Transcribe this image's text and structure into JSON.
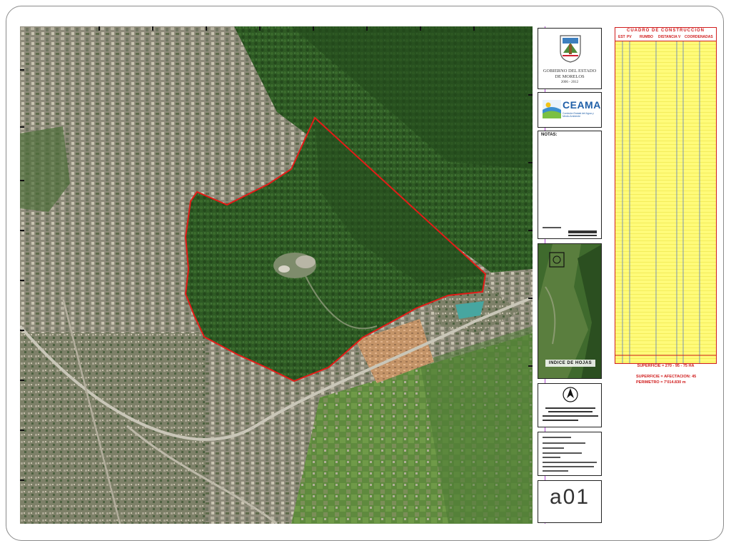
{
  "map": {
    "description_label": "aerial-orthophoto",
    "boundary_color": "#e41b17",
    "forest_color": "#2c5a22",
    "urban_color": "#8c8a78"
  },
  "title_block": {
    "government": {
      "line1": "GOBIERNO DEL ESTADO",
      "line2": "DE MORELOS",
      "period": "2006 - 2012"
    },
    "agency": {
      "logo_text": "CEAMA",
      "subtitle": "Comisión Estatal del Agua y Medio Ambiente"
    },
    "notes_label": "NOTAS:",
    "index_label": "INDICE DE HOJAS",
    "sheet_code": "a01"
  },
  "construction_table": {
    "title": "CUADRO DE CONSTRUCCION",
    "headers": [
      "EST",
      "PV",
      "RUMBO",
      "DISTANCIA",
      "V",
      "COORDENADAS"
    ],
    "border_color": "#d01c1c",
    "fill_color": "#fffb7a",
    "footer_line1": "SUPERFICIE = 270 - 95 - 75 HA",
    "footer_line2": "SUPERFICIE = AFECTACION: 45",
    "footer_line3": "PERIMETRO = 7'014.830 m"
  }
}
